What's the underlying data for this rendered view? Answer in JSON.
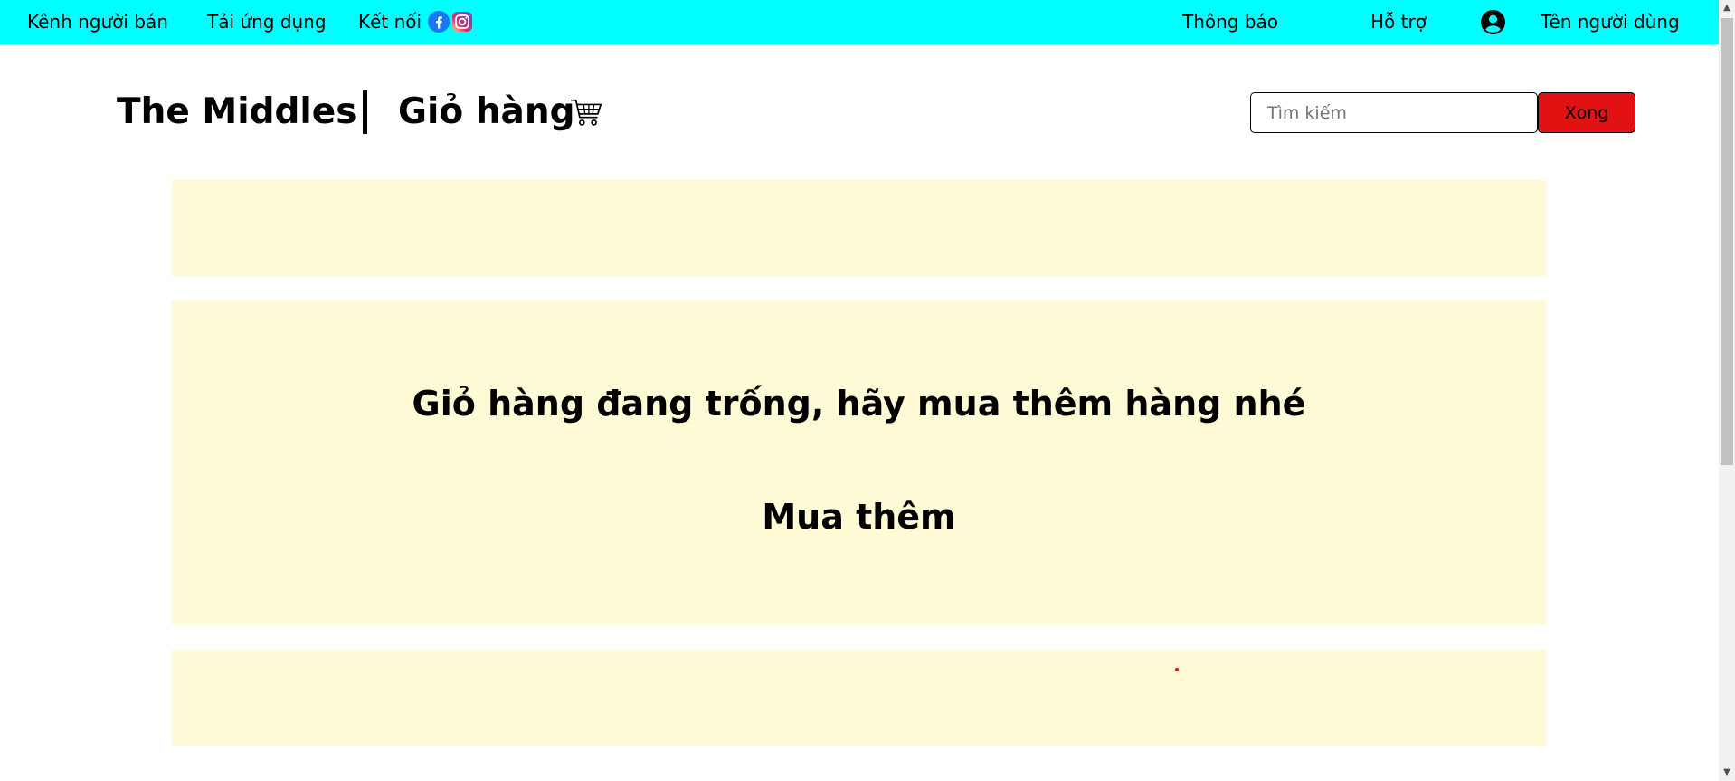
{
  "topbar": {
    "seller_channel": "Kênh người bán",
    "download_app": "Tải ứng dụng",
    "connect": "Kết nối",
    "notifications": "Thông báo",
    "support": "Hỗ trợ",
    "username": "Tên người dùng",
    "icons": [
      "facebook-icon",
      "instagram-icon",
      "user-circle-icon"
    ]
  },
  "header": {
    "brand": "The Middles",
    "title": "Giỏ hàng",
    "cart_icon": "shopping-cart-icon"
  },
  "search": {
    "placeholder": "Tìm kiếm",
    "value": "",
    "button_label": "Xong"
  },
  "cart": {
    "empty_message": "Giỏ hàng đang trống, hãy mua thêm hàng nhé",
    "buy_more": "Mua thêm"
  },
  "colors": {
    "topbar_bg": "#00ffff",
    "panel_bg": "#fffad6",
    "search_button_bg": "#e31212",
    "facebook": "#1877f2",
    "instagram": "#e4405f"
  }
}
